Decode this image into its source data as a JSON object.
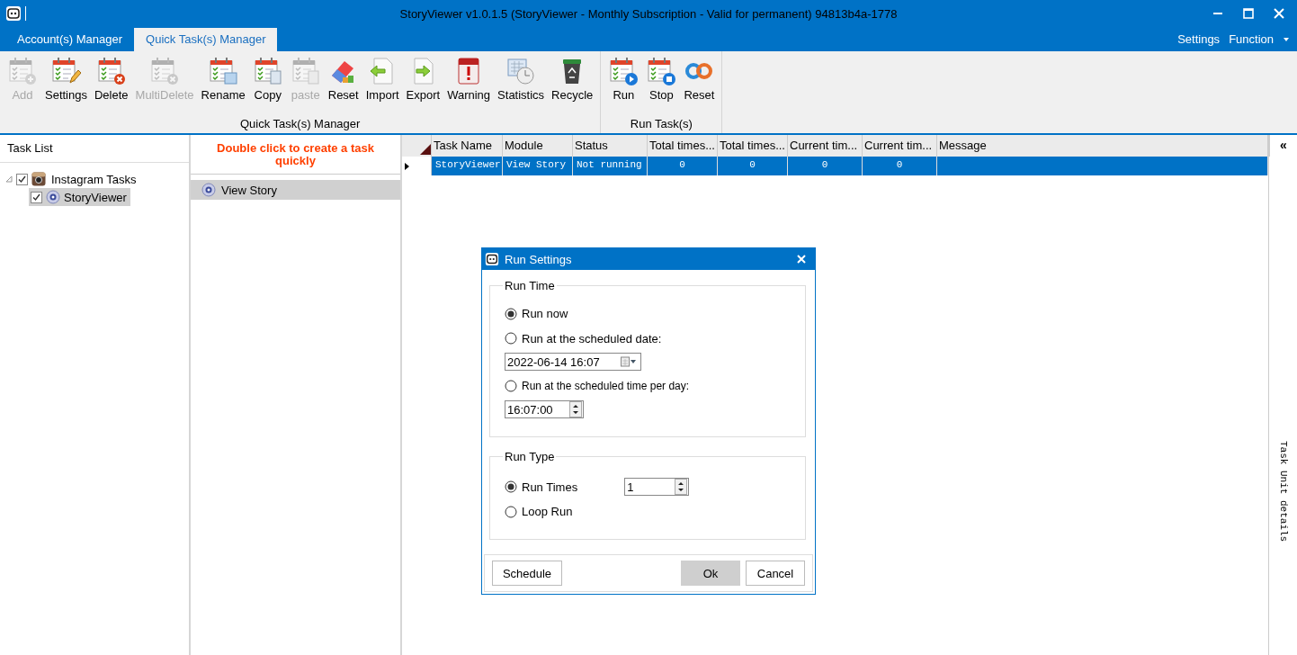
{
  "window": {
    "title": "StoryViewer v1.0.1.5 (StoryViewer - Monthly Subscription - Valid for permanent) 94813b4a-1778"
  },
  "tabs": [
    {
      "label": "Account(s) Manager",
      "selected": false
    },
    {
      "label": "Quick Task(s) Manager",
      "selected": true
    }
  ],
  "menu": [
    {
      "label": "Settings"
    },
    {
      "label": "Function"
    }
  ],
  "ribbon_groups": [
    {
      "label": "Quick Task(s) Manager",
      "buttons": [
        {
          "label": "Add",
          "disabled": true
        },
        {
          "label": "Settings",
          "disabled": false
        },
        {
          "label": "Delete",
          "disabled": false
        },
        {
          "label": "MultiDelete",
          "disabled": true
        },
        {
          "label": "Rename",
          "disabled": false
        },
        {
          "label": "Copy",
          "disabled": false
        },
        {
          "label": "paste",
          "disabled": true
        },
        {
          "label": "Reset",
          "disabled": false
        },
        {
          "label": "Import",
          "disabled": false
        },
        {
          "label": "Export",
          "disabled": false
        },
        {
          "label": "Warning",
          "disabled": false
        },
        {
          "label": "Statistics",
          "disabled": false
        },
        {
          "label": "Recycle",
          "disabled": false
        }
      ]
    },
    {
      "label": "Run Task(s)",
      "buttons": [
        {
          "label": "Run",
          "disabled": false
        },
        {
          "label": "Stop",
          "disabled": false
        },
        {
          "label": "Reset",
          "disabled": false
        }
      ]
    }
  ],
  "task_list": {
    "title": "Task List",
    "items": [
      {
        "label": "Instagram Tasks",
        "checked": true,
        "expanded": true,
        "selected": false,
        "children": [
          {
            "label": "StoryViewer",
            "checked": true,
            "selected": true
          }
        ]
      }
    ]
  },
  "modules": {
    "hint": "Double click to create a task quickly",
    "items": [
      {
        "label": "View Story",
        "selected": true
      }
    ]
  },
  "table": {
    "columns": [
      "Task Name",
      "Module",
      "Status",
      "Total times...",
      "Total times...",
      "Current tim...",
      "Current tim...",
      "Message"
    ],
    "rows": [
      {
        "selected": true,
        "cells": [
          "StoryViewer",
          "View Story",
          "Not running",
          "0",
          "0",
          "0",
          "0",
          ""
        ]
      }
    ]
  },
  "side_panel": {
    "collapse": "«",
    "title": "Task Unit details"
  },
  "dialog": {
    "title": "Run Settings",
    "groups": [
      {
        "label": "Run Time",
        "options": [
          {
            "label": "Run now",
            "selected": true
          },
          {
            "label": "Run at the scheduled date:",
            "selected": false,
            "field": {
              "kind": "date",
              "value": "2022-06-14 16:07"
            }
          },
          {
            "label": "Run at the scheduled time per day:",
            "selected": false,
            "field": {
              "kind": "time",
              "value": "16:07:00"
            }
          }
        ]
      },
      {
        "label": "Run Type",
        "options": [
          {
            "label": "Run Times",
            "selected": true,
            "field": {
              "kind": "spin",
              "value": "1"
            }
          },
          {
            "label": "Loop Run",
            "selected": false
          }
        ]
      }
    ],
    "buttons": [
      {
        "label": "Schedule",
        "kind": "left"
      },
      {
        "label": "Ok",
        "kind": "default"
      },
      {
        "label": "Cancel",
        "kind": "normal"
      }
    ]
  }
}
